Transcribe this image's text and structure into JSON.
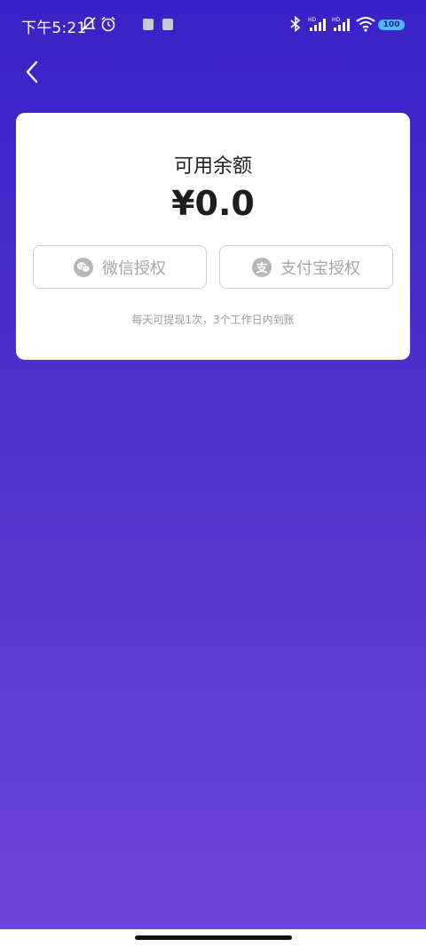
{
  "status_bar": {
    "time": "下午5:21",
    "battery": "100",
    "icons": [
      "mute-bell-icon",
      "alarm-icon",
      "app-notification-icon",
      "app-notification-icon",
      "bluetooth-icon",
      "signal-hd-icon",
      "signal-hd-icon",
      "wifi-icon",
      "battery-icon"
    ]
  },
  "header": {
    "back_icon": "chevron-left-icon"
  },
  "balance_card": {
    "label": "可用余额",
    "amount": "¥0.0",
    "wechat_button": {
      "label": "微信授权",
      "icon": "wechat-icon"
    },
    "alipay_button": {
      "label": "支付宝授权",
      "icon": "alipay-icon",
      "glyph": "支"
    },
    "note": "每天可提现1次，3个工作日内到账"
  },
  "colors": {
    "background_top": "#3a22c6",
    "background_bottom": "#6e46da",
    "card": "#ffffff",
    "button_border": "#cfcfcf",
    "button_text": "#a6a6a6"
  }
}
